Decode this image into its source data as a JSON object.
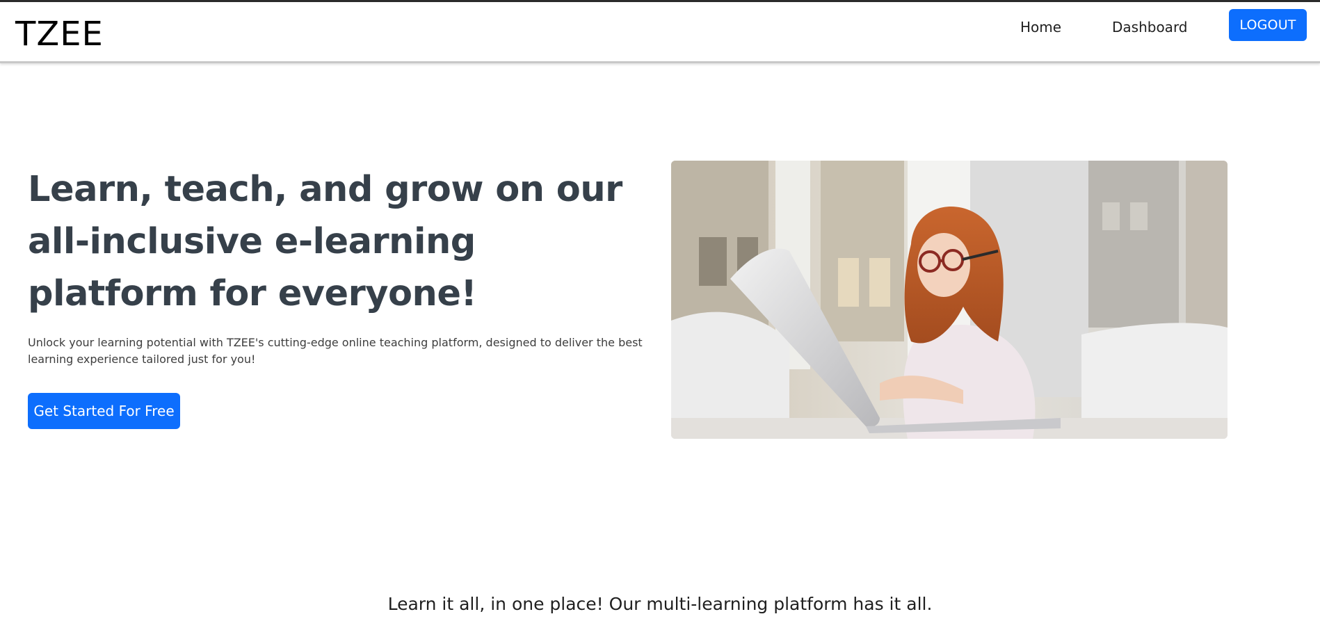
{
  "header": {
    "brand": "TZEE",
    "nav": {
      "home_label": "Home",
      "dashboard_label": "Dashboard",
      "logout_label": "LOGOUT"
    }
  },
  "hero": {
    "title": "Learn, teach, and grow on our all-inclusive e-learning platform for everyone!",
    "subtitle": "Unlock your learning potential with TZEE's cutting-edge online teaching platform, designed to deliver the best learning experience tailored just for you!",
    "cta_label": "Get Started For Free",
    "image_icon": "girl-with-laptop-photo"
  },
  "section": {
    "tagline": "Learn it all, in one place! Our multi-learning platform has it all."
  },
  "colors": {
    "primary": "#0d6efd",
    "heading": "#36404a"
  }
}
